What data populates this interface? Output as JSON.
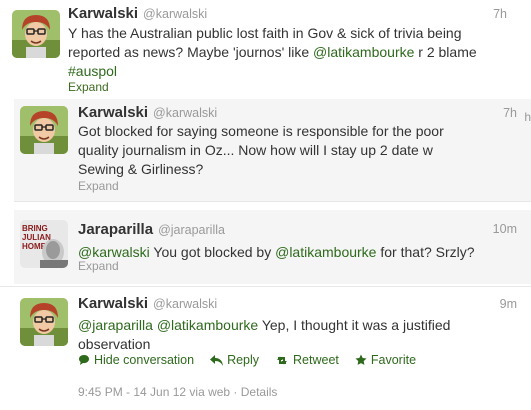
{
  "tweets": [
    {
      "fullname": "Karwalski",
      "handle": "@karwalski",
      "time": "7h",
      "text_parts": {
        "a": "Y has the Australian public lost faith in Gov & sick of trivia being reported as news? Maybe 'journos' like ",
        "mention": "@latikambourke",
        "b": " r 2 blame ",
        "hashtag": "#auspol"
      },
      "expand": "Expand"
    },
    {
      "fullname": "Karwalski",
      "handle": "@karwalski",
      "time": "7h",
      "text": "Got blocked for saying someone is responsible for the poor quality journalism in Oz... Now how will I stay up 2 date w Sewing & Girliness?",
      "expand": "Expand"
    },
    {
      "fullname": "Jaraparilla",
      "handle": "@jaraparilla",
      "time": "10m",
      "text_parts": {
        "mention1": "@karwalski",
        "a": " You got blocked by ",
        "mention2": "@latikambourke",
        "b": " for that? Srzly?"
      },
      "avatar_text": "BRING JULIAN HOME",
      "expand": "Expand"
    },
    {
      "fullname": "Karwalski",
      "handle": "@karwalski",
      "time": "9m",
      "text_parts": {
        "mention1": "@jaraparilla",
        "mention2": "@latikambourke",
        "b": " Yep, I thought it was a justified observation"
      },
      "actions": {
        "hide": "Hide conversation",
        "reply": "Reply",
        "retweet": "Retweet",
        "favorite": "Favorite"
      },
      "meta": "9:45 PM - 14 Jun 12 via web · Details"
    }
  ],
  "cut_glyph": "h",
  "colors": {
    "link": "#2e6a1c",
    "muted": "#999999",
    "conversation_bg": "#f5f5f5"
  }
}
